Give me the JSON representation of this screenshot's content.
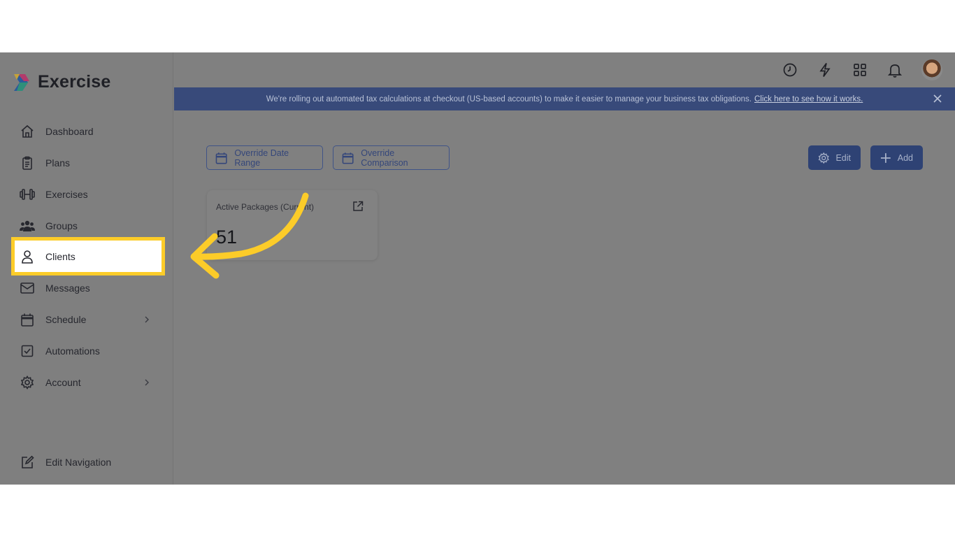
{
  "app": {
    "name": "Exercise"
  },
  "sidebar": {
    "items": [
      {
        "label": "Dashboard",
        "icon": "home-icon"
      },
      {
        "label": "Plans",
        "icon": "clipboard-icon"
      },
      {
        "label": "Exercises",
        "icon": "dumbbell-icon"
      },
      {
        "label": "Groups",
        "icon": "users-icon"
      },
      {
        "label": "Clients",
        "icon": "user-icon",
        "active": true
      },
      {
        "label": "Messages",
        "icon": "mail-icon"
      },
      {
        "label": "Schedule",
        "icon": "calendar-icon",
        "expandable": true
      },
      {
        "label": "Automations",
        "icon": "checkbox-icon"
      },
      {
        "label": "Account",
        "icon": "gear-icon",
        "expandable": true
      }
    ],
    "edit_navigation": "Edit Navigation"
  },
  "topbar": {
    "icons": [
      "history-icon",
      "bolt-icon",
      "apps-grid-icon",
      "bell-icon",
      "avatar"
    ]
  },
  "banner": {
    "text": "We're rolling out automated tax calculations at checkout (US-based accounts) to make it easier to manage your business tax obligations.",
    "link": "Click here to see how it works."
  },
  "toolbar": {
    "override_date_range": "Override Date Range",
    "override_comparison": "Override Comparison",
    "edit": "Edit",
    "add": "Add"
  },
  "card": {
    "title": "Active Packages (Current)",
    "value": "51"
  },
  "colors": {
    "highlight": "#fccc29",
    "accent": "#2e4274",
    "overlay": "#808080"
  }
}
